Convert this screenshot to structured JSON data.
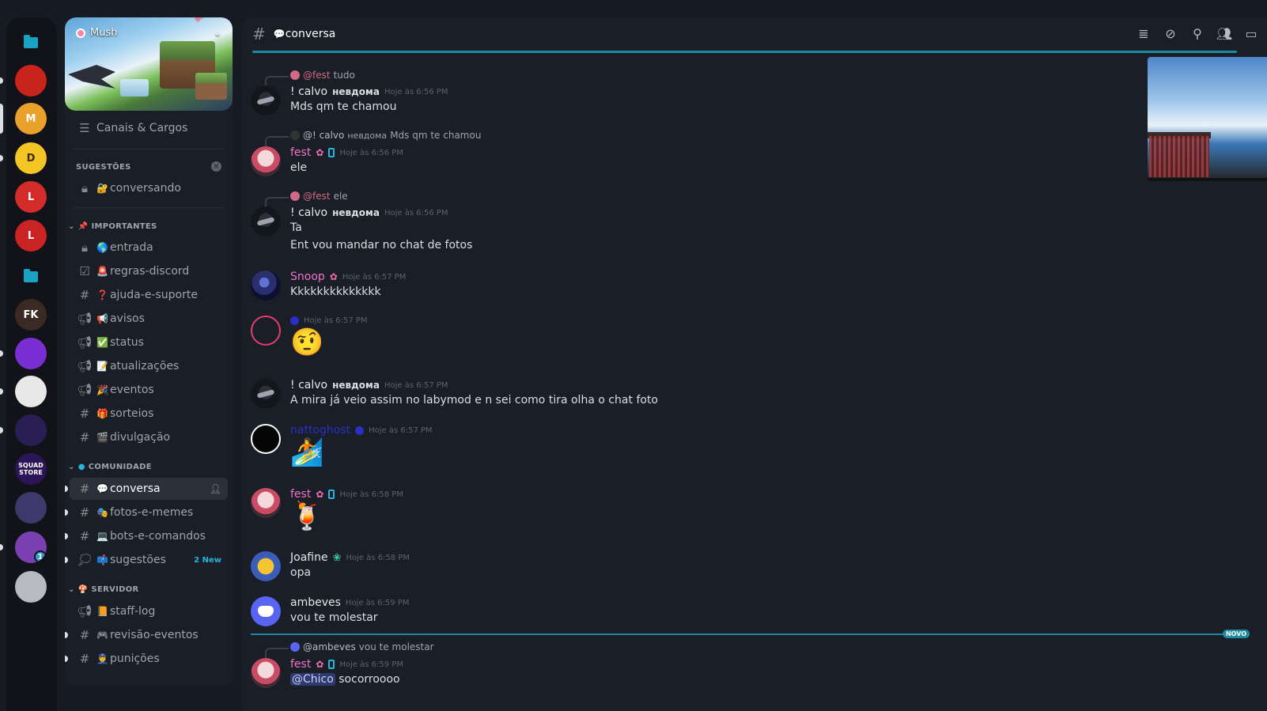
{
  "servers": [
    {
      "name": "folder-1",
      "kind": "folder"
    },
    {
      "name": "red-hero",
      "label": "",
      "color": "#c8241c"
    },
    {
      "name": "mush-active",
      "label": "M",
      "color": "#e9a12b"
    },
    {
      "name": "yellow-d",
      "label": "D",
      "color": "#f3c623"
    },
    {
      "name": "red-l-1",
      "label": "L",
      "color": "#d42b2b"
    },
    {
      "name": "red-l-2",
      "label": "L",
      "color": "#c92323"
    },
    {
      "name": "folder-2",
      "kind": "folder"
    },
    {
      "name": "fk",
      "label": "FK",
      "color": "#3b2a24"
    },
    {
      "name": "purple",
      "label": "",
      "color": "#7a2fd4"
    },
    {
      "name": "soccer",
      "label": "",
      "color": "#e8e8e8"
    },
    {
      "name": "spiral",
      "label": "",
      "color": "#2a1f55"
    },
    {
      "name": "squad",
      "label": "SQUAD STORE",
      "color": "#2b1458"
    },
    {
      "name": "game-art",
      "label": "",
      "color": "#3d3a6b"
    },
    {
      "name": "colorful",
      "label": "",
      "color": "#7a3fb0",
      "badge": "1"
    },
    {
      "name": "anime",
      "label": "",
      "color": "#b9b9c2"
    }
  ],
  "server": {
    "name": "Mush"
  },
  "sidebar": {
    "channels_roles": "Canais & Cargos",
    "suggestions_header": "SUGESTÕES",
    "suggestion_item": {
      "emoji": "🔐",
      "label": "conversando"
    },
    "categories": {
      "importantes": "IMPORTANTES",
      "comunidade": "COMUNIDADE",
      "servidor": "SERVIDOR"
    },
    "importantes": [
      {
        "icon": "lock",
        "emoji": "🌎",
        "label": "entrada"
      },
      {
        "icon": "rules",
        "emoji": "🚨",
        "label": "regras-discord"
      },
      {
        "icon": "hash",
        "emoji": "❓",
        "label": "ajuda-e-suporte"
      },
      {
        "icon": "megaphone",
        "emoji": "📢",
        "label": "avisos"
      },
      {
        "icon": "megaphone",
        "emoji": "✅",
        "label": "status"
      },
      {
        "icon": "megaphone",
        "emoji": "📝",
        "label": "atualizações"
      },
      {
        "icon": "megaphone",
        "emoji": "🎉",
        "label": "eventos"
      },
      {
        "icon": "hash",
        "emoji": "🎁",
        "label": "sorteios"
      },
      {
        "icon": "hash",
        "emoji": "🎬",
        "label": "divulgação"
      }
    ],
    "comunidade": [
      {
        "icon": "hash",
        "emoji": "💬",
        "label": "conversa",
        "active": true
      },
      {
        "icon": "hash",
        "emoji": "🎭",
        "label": "fotos-e-memes"
      },
      {
        "icon": "hash",
        "emoji": "💻",
        "label": "bots-e-comandos"
      },
      {
        "icon": "forum",
        "emoji": "📫",
        "label": "sugestões",
        "new": "2 New"
      }
    ],
    "servidor": [
      {
        "icon": "megaphone",
        "emoji": "📙",
        "label": "staff-log"
      },
      {
        "icon": "hash",
        "emoji": "🎮",
        "label": "revisão-eventos"
      },
      {
        "icon": "hash",
        "emoji": "👮",
        "label": "punições"
      }
    ]
  },
  "channel": {
    "emoji": "💬",
    "name": "conversa"
  },
  "toolbar": [
    "threads-icon",
    "mute-icon",
    "pin-icon",
    "members-icon",
    "inbox-icon"
  ],
  "messages": {
    "m1": {
      "reply_user": "@fest",
      "reply_text": "tudo",
      "author": "! calvo",
      "tag": "невдома",
      "time": "Hoje às 6:56 PM",
      "text": "Mds qm te chamou"
    },
    "m2": {
      "reply_user": "@! calvo",
      "reply_tag": "невдома",
      "reply_text": "Mds qm te chamou",
      "author": "fest",
      "time": "Hoje às 6:56 PM",
      "text": "ele"
    },
    "m3": {
      "reply_user": "@fest",
      "reply_text": "ele",
      "author": "! calvo",
      "tag": "невдома",
      "time": "Hoje às 6:56 PM",
      "text": "Ta",
      "text2": "Ent vou mandar no chat de fotos"
    },
    "m4": {
      "author": "Snoop",
      "time": "Hoje às 6:57 PM",
      "text": "Kkkkkkkkkkkkkk"
    },
    "m5": {
      "time": "Hoje às 6:57 PM",
      "emoji": "🤨"
    },
    "m6": {
      "author": "! calvo",
      "tag": "невдома",
      "time": "Hoje às 6:57 PM",
      "text": "A mira já veio assim no labymod e n sei como tira olha o chat foto"
    },
    "m7": {
      "author": "nattoghost",
      "time": "Hoje às 6:57 PM",
      "emoji": "🏄"
    },
    "m8": {
      "author": "fest",
      "time": "Hoje às 6:58 PM",
      "emoji": "🍹"
    },
    "m9": {
      "author": "Joafine",
      "time": "Hoje às 6:58 PM",
      "text": "opa"
    },
    "m10": {
      "author": "ambeves",
      "time": "Hoje às 6:59 PM",
      "text": "vou te molestar"
    },
    "m11": {
      "reply_user": "@ambeves",
      "reply_text": "vou te molestar",
      "author": "fest",
      "time": "Hoje às 6:59 PM",
      "mention": "@Chico",
      "text": "socorroooo"
    }
  },
  "new_divider": "NOVO"
}
